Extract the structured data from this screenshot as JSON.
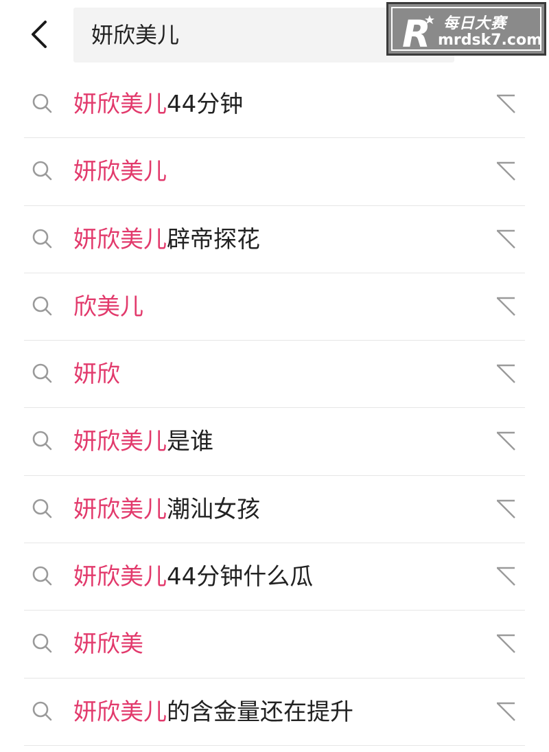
{
  "search": {
    "query": "妍欣美儿"
  },
  "watermark": {
    "brand_cn": "每日大赛",
    "url": "mrdsk7.com",
    "logo_letter": "R"
  },
  "colors": {
    "highlight": "#e23a6c",
    "text": "#222222",
    "icon": "#9a9a9a"
  },
  "suggestions": [
    {
      "highlight": "妍欣美儿",
      "rest": "44分钟"
    },
    {
      "highlight": "妍欣美儿",
      "rest": ""
    },
    {
      "highlight": "妍欣美儿",
      "rest": "辟帝探花"
    },
    {
      "highlight": "欣美儿",
      "rest": ""
    },
    {
      "highlight": "妍欣",
      "rest": ""
    },
    {
      "highlight": "妍欣美儿",
      "rest": "是谁"
    },
    {
      "highlight": "妍欣美儿",
      "rest": "潮汕女孩"
    },
    {
      "highlight": "妍欣美儿",
      "rest": "44分钟什么瓜"
    },
    {
      "highlight": "妍欣美",
      "rest": ""
    },
    {
      "highlight": "妍欣美儿",
      "rest": "的含金量还在提升"
    }
  ]
}
